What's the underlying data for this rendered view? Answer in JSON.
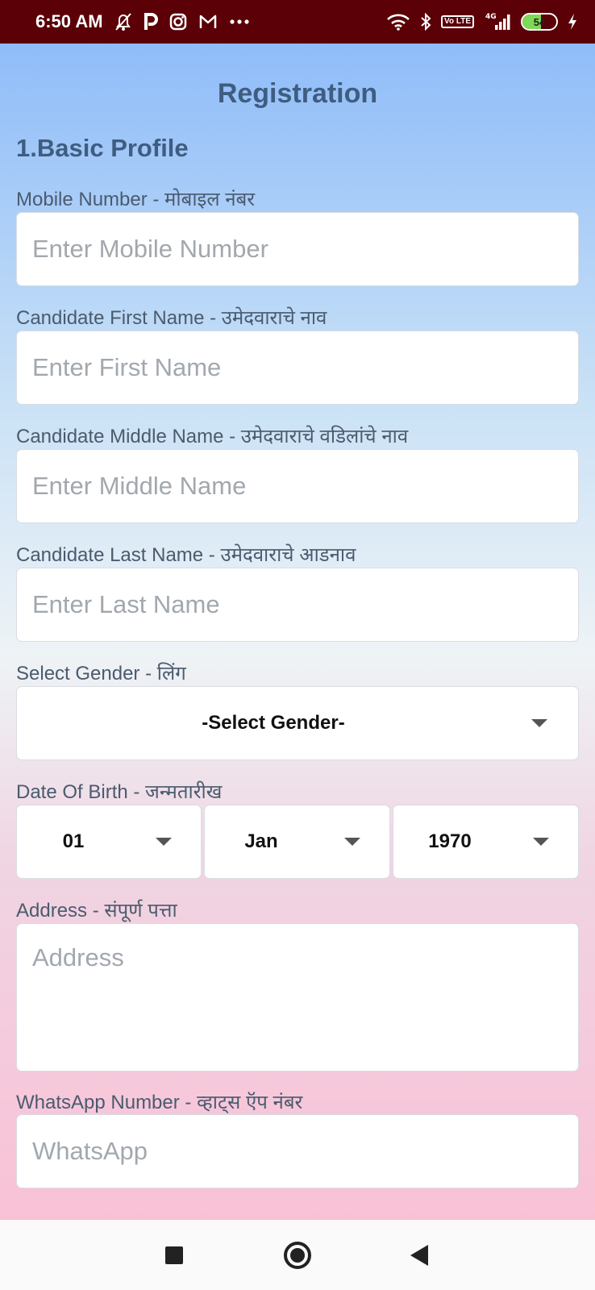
{
  "status_bar": {
    "time": "6:50 AM",
    "left_icons": [
      "mute-bell-icon",
      "paytm-icon",
      "instagram-icon",
      "gmail-icon",
      "more-dots-icon"
    ],
    "right_icons": [
      "wifi-icon",
      "bluetooth-icon",
      "volte-icon",
      "signal-icon",
      "battery-icon",
      "charging-icon"
    ],
    "network": "4G",
    "volte_label": "Vo LTE",
    "battery": "54"
  },
  "page": {
    "title": "Registration",
    "section_title": "1.Basic Profile"
  },
  "form": {
    "mobile": {
      "label": "Mobile Number - मोबाइल नंबर",
      "placeholder": "Enter Mobile Number"
    },
    "first_name": {
      "label": "Candidate First Name - उमेदवाराचे नाव",
      "placeholder": "Enter First Name"
    },
    "middle_name": {
      "label": "Candidate Middle Name - उमेदवाराचे वडिलांचे नाव",
      "placeholder": "Enter Middle Name"
    },
    "last_name": {
      "label": "Candidate Last Name - उमेदवाराचे आडनाव",
      "placeholder": "Enter Last Name"
    },
    "gender": {
      "label": "Select Gender - लिंग",
      "selected": "-Select Gender-"
    },
    "dob": {
      "label": "Date Of Birth - जन्मतारीख",
      "day": "01",
      "month": "Jan",
      "year": "1970"
    },
    "address": {
      "label": "Address - संपूर्ण पत्ता",
      "placeholder": "Address"
    },
    "whatsapp": {
      "label": "WhatsApp Number - व्हाट्स ऍप नंबर",
      "placeholder": "WhatsApp"
    }
  },
  "nav": {
    "icons": [
      "recents-square-icon",
      "home-circle-icon",
      "back-triangle-icon"
    ]
  },
  "colors": {
    "status_bar": "#5a0006",
    "title_text": "#3f5d80",
    "gradient_top": "#8fbcf9",
    "gradient_bottom": "#f9c1d6"
  }
}
